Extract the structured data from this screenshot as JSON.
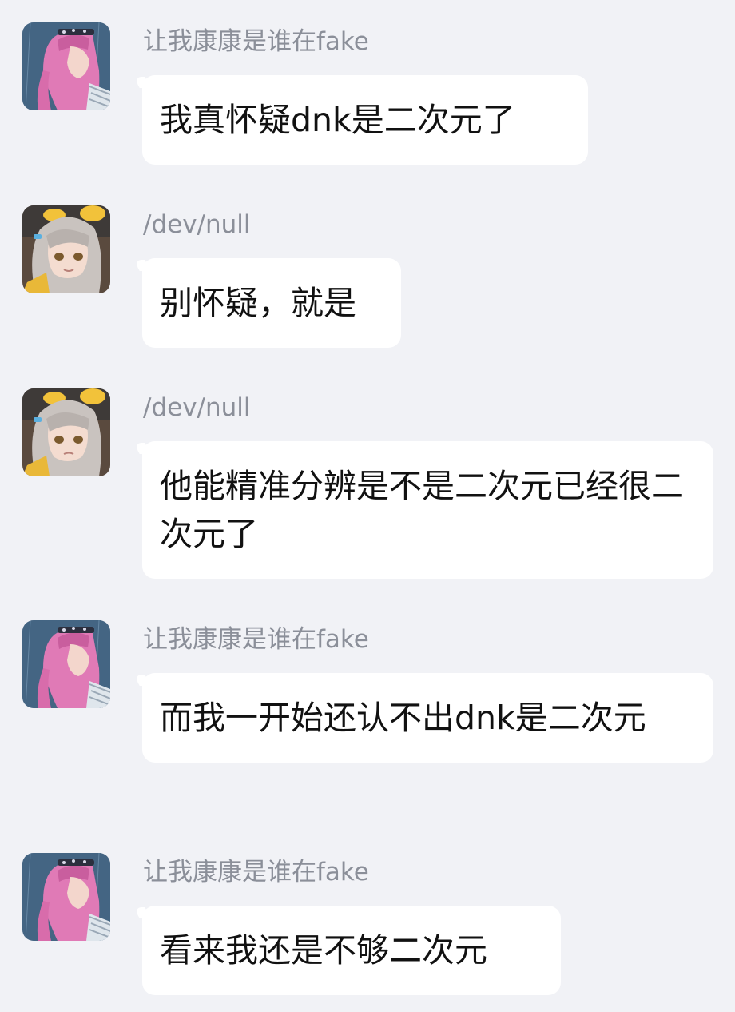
{
  "messages": [
    {
      "sender": "让我康康是谁在fake",
      "avatar": "pink-hair-avatar-icon",
      "text": "我真怀疑dnk是二次元了"
    },
    {
      "sender": "/dev/null",
      "avatar": "silver-hair-avatar-icon",
      "text": "别怀疑，就是"
    },
    {
      "sender": "/dev/null",
      "avatar": "silver-hair-avatar-icon",
      "text": "他能精准分辨是不是二次元已经很二次元了"
    },
    {
      "sender": "让我康康是谁在fake",
      "avatar": "pink-hair-avatar-icon",
      "text": "而我一开始还认不出dnk是二次元"
    },
    {
      "sender": "让我康康是谁在fake",
      "avatar": "pink-hair-avatar-icon",
      "text": "看来我还是不够二次元"
    }
  ],
  "colors": {
    "background": "#f1f2f6",
    "bubble": "#ffffff",
    "sender_name": "#8b8f99",
    "message_text": "#111111"
  }
}
